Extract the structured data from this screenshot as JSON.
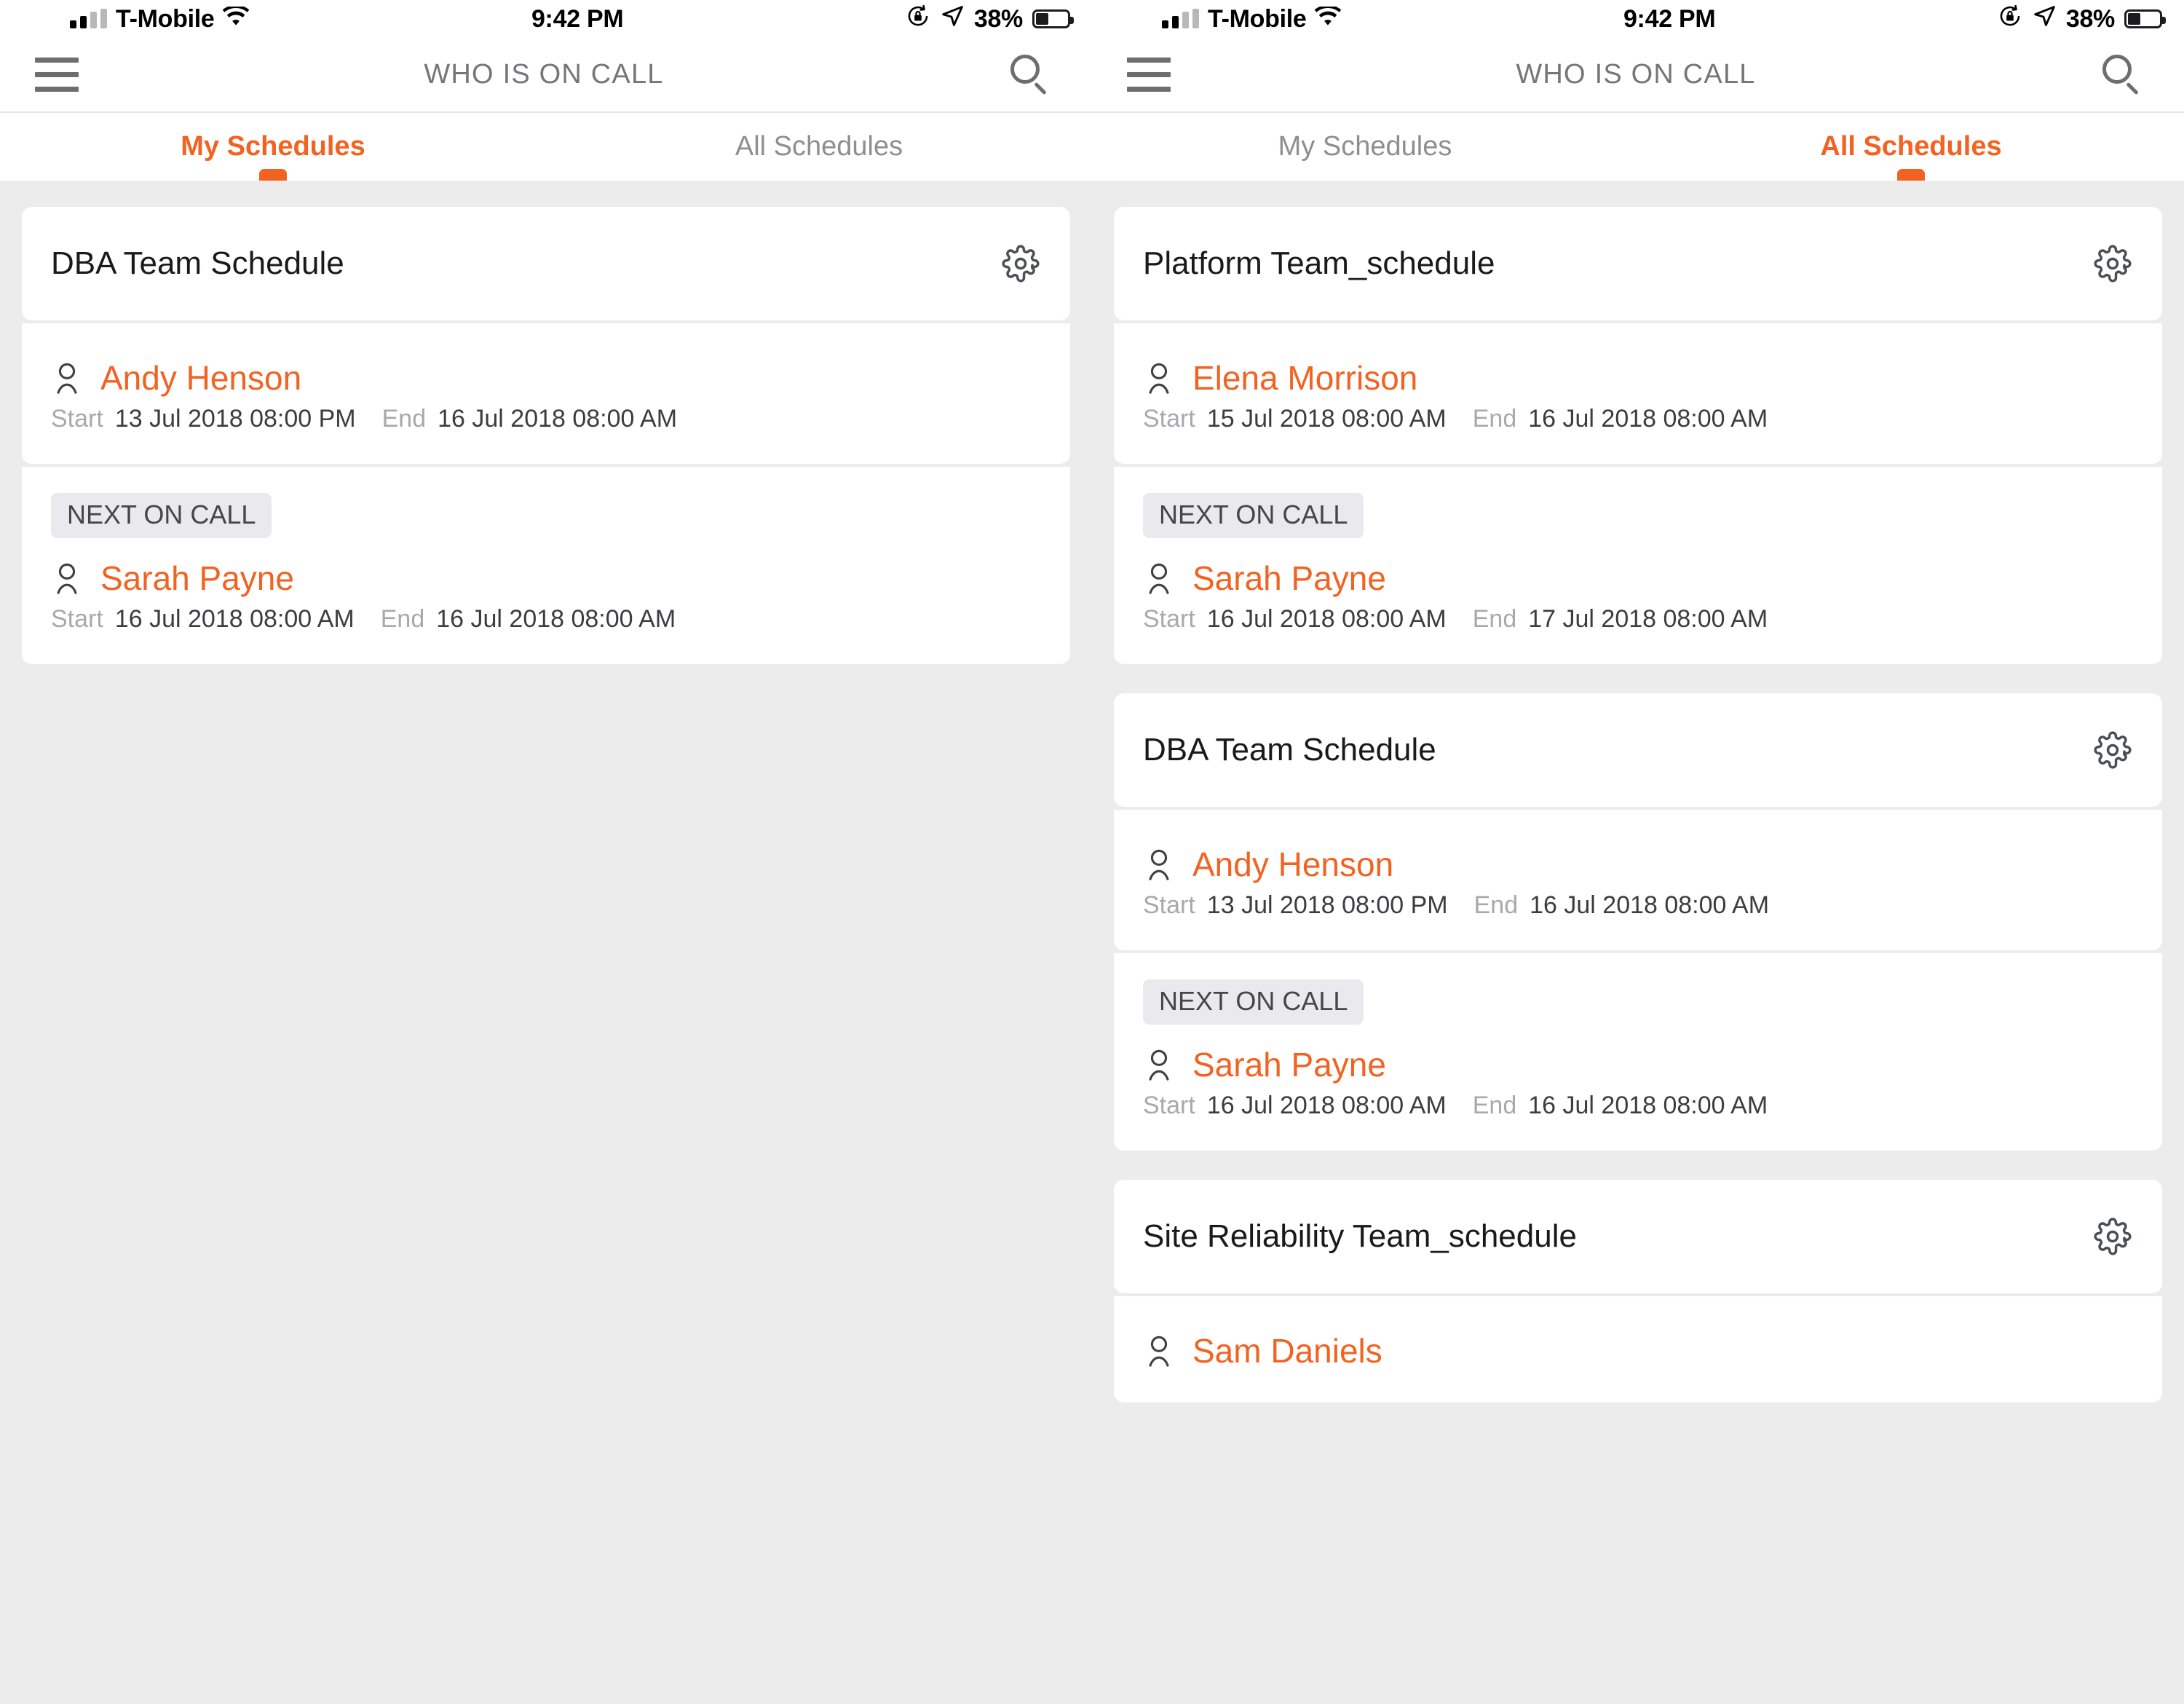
{
  "status_bar": {
    "carrier": "T-Mobile",
    "time": "9:42 PM",
    "battery_percent": "38%",
    "icons": [
      "signal-bars-icon",
      "wifi-icon",
      "rotation-lock-icon",
      "location-arrow-icon",
      "battery-icon"
    ]
  },
  "nav": {
    "title": "WHO IS ON CALL",
    "menu_icon": "hamburger-menu-icon",
    "search_icon": "search-icon"
  },
  "colors": {
    "accent": "#f26322",
    "inactive_tab": "#8e8e93",
    "content_bg": "#ececed",
    "card_bg": "#ffffff",
    "badge_bg": "#e9e9ee",
    "label_gray": "#a8a8ad"
  },
  "labels": {
    "start": "Start",
    "end": "End",
    "next_on_call": "NEXT ON CALL"
  },
  "panels": [
    {
      "id": "left",
      "tabs": [
        {
          "label": "My Schedules",
          "active": true
        },
        {
          "label": "All Schedules",
          "active": false
        }
      ],
      "cards": [
        {
          "title": "DBA Team Schedule",
          "shifts": [
            {
              "badge": null,
              "name": "Andy Henson",
              "start": "13 Jul 2018 08:00 PM",
              "end": "16 Jul 2018 08:00 AM"
            },
            {
              "badge": "NEXT ON CALL",
              "name": "Sarah Payne",
              "start": "16 Jul 2018 08:00 AM",
              "end": "16 Jul 2018 08:00 AM"
            }
          ]
        }
      ]
    },
    {
      "id": "right",
      "tabs": [
        {
          "label": "My Schedules",
          "active": false
        },
        {
          "label": "All Schedules",
          "active": true
        }
      ],
      "cards": [
        {
          "title": "Platform Team_schedule",
          "shifts": [
            {
              "badge": null,
              "name": "Elena Morrison",
              "start": "15 Jul 2018 08:00 AM",
              "end": "16 Jul 2018 08:00 AM"
            },
            {
              "badge": "NEXT ON CALL",
              "name": "Sarah Payne",
              "start": "16 Jul 2018 08:00 AM",
              "end": "17 Jul 2018 08:00 AM"
            }
          ]
        },
        {
          "title": "DBA Team Schedule",
          "shifts": [
            {
              "badge": null,
              "name": "Andy Henson",
              "start": "13 Jul 2018 08:00 PM",
              "end": "16 Jul 2018 08:00 AM"
            },
            {
              "badge": "NEXT ON CALL",
              "name": "Sarah Payne",
              "start": "16 Jul 2018 08:00 AM",
              "end": "16 Jul 2018 08:00 AM"
            }
          ]
        },
        {
          "title": "Site Reliability Team_schedule",
          "shifts": [
            {
              "badge": null,
              "name": "Sam Daniels",
              "start": null,
              "end": null
            }
          ]
        }
      ]
    }
  ]
}
